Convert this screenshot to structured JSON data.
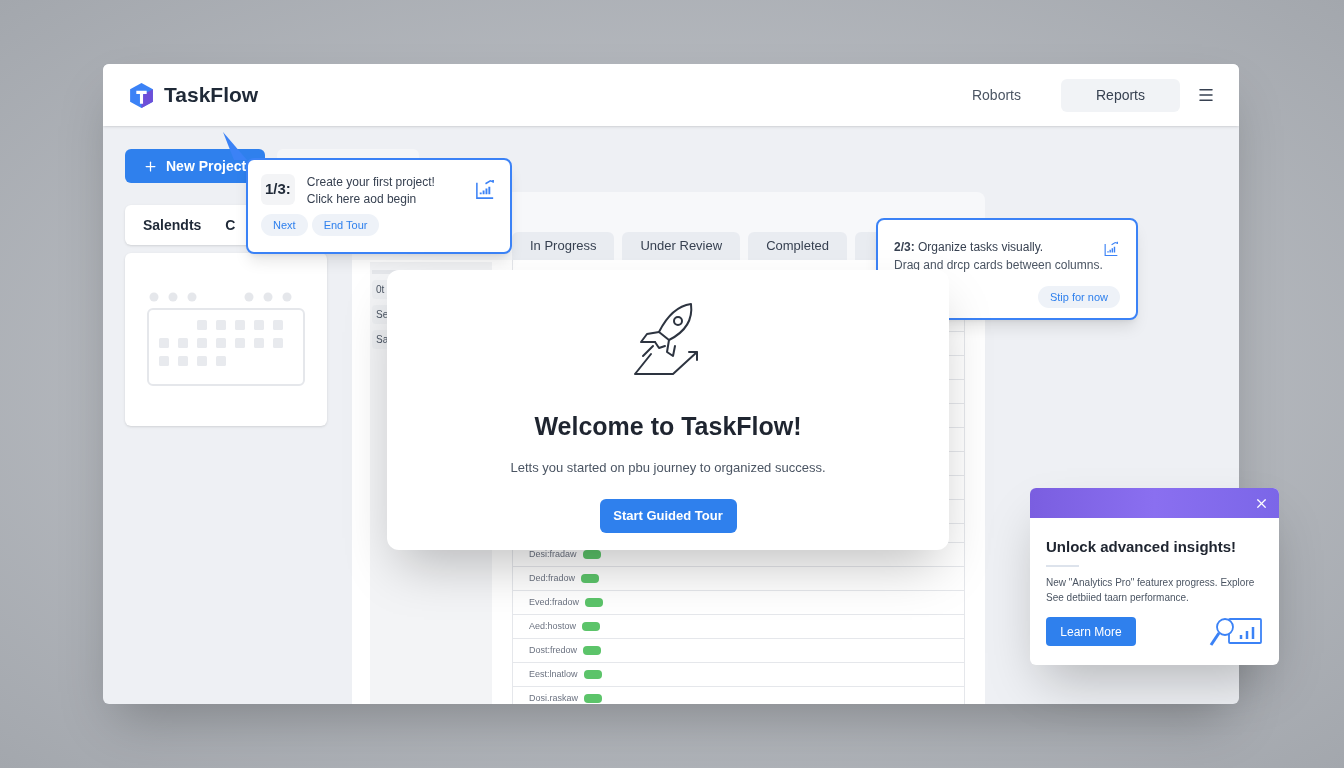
{
  "header": {
    "app_name": "TaskFlow",
    "nav_link": "Roborts",
    "nav_button": "Reports"
  },
  "sidebar": {
    "new_button": "New Project",
    "card_title": "Salendts",
    "card_title_2": "C"
  },
  "board": {
    "tabs": [
      {
        "label": "In Progress"
      },
      {
        "label": "Under Review"
      },
      {
        "label": "Completed"
      }
    ],
    "list_items": [
      "0t",
      "Se",
      "Sa"
    ],
    "rows": [
      "Desi:fradaw",
      "Ded:fradow",
      "Eved:fradow",
      "Aed:hostow",
      "Dost:fredow",
      "Eest:lnatlow",
      "Dosi.raskaw"
    ]
  },
  "tour_step_1": {
    "step": "1/3:",
    "lines": [
      "Create your first project!",
      "Click here aod begin"
    ],
    "buttons": [
      "Next",
      "End Tour"
    ]
  },
  "tour_step_2": {
    "line_1": "**2/3:** Organize tasks visually.",
    "line_2": "Drag and drcp cards between columns.",
    "button": "Stip for now"
  },
  "welcome_modal": {
    "title": "Welcome to TaskFlow!",
    "subtitle": "Letts you started on pbu journey to organized success.",
    "button": "Start Guided Tour"
  },
  "promo_popup": {
    "title": "Unlock advanced insights!",
    "body_lines": [
      "New \"Analytics Pro\" featurex progress. Explore",
      "See detbiied taarn performance."
    ],
    "button": "Learn More"
  }
}
